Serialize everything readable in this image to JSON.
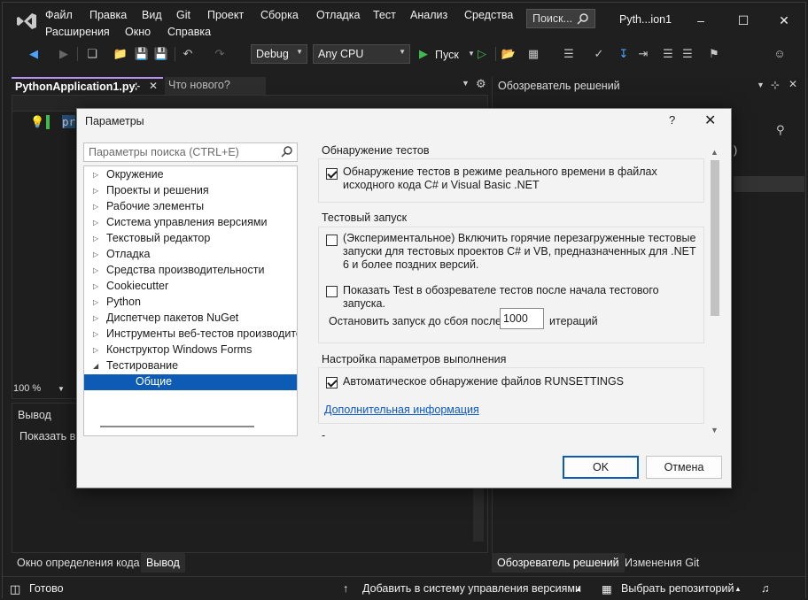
{
  "window": {
    "menu": [
      "Файл",
      "Правка",
      "Вид",
      "Git",
      "Проект",
      "Сборка",
      "Отладка",
      "Тест",
      "Анализ",
      "Средства",
      "Расширения",
      "Окно",
      "Справка"
    ],
    "search_label": "Поиск...",
    "title": "Pyth...ion1"
  },
  "toolbar": {
    "config": "Debug",
    "platform": "Any CPU",
    "run_label": "Пуск"
  },
  "editor": {
    "active_tab": "PythonApplication1.py",
    "inactive_tab": "Что нового?",
    "code_snippet": "pr",
    "zoom": "100 %"
  },
  "output": {
    "title": "Вывод",
    "show_label": "Показать вы"
  },
  "bottom_tabs_left": [
    "Окно определения кода",
    "Вывод"
  ],
  "solution": {
    "title": "Обозреватель решений",
    "fragment": ")"
  },
  "bottom_tabs_right": [
    "Обозреватель решений",
    "Изменения Git"
  ],
  "status": {
    "ready": "Готово",
    "add_vcs": "Добавить в систему управления версиями",
    "select_repo": "Выбрать репозиторий"
  },
  "dialog": {
    "title": "Параметры",
    "help": "?",
    "search_placeholder": "Параметры поиска (CTRL+E)",
    "tree": [
      {
        "label": "Окружение",
        "expanded": false
      },
      {
        "label": "Проекты и решения",
        "expanded": false
      },
      {
        "label": "Рабочие элементы",
        "expanded": false
      },
      {
        "label": "Система управления версиями",
        "expanded": false
      },
      {
        "label": "Текстовый редактор",
        "expanded": false
      },
      {
        "label": "Отладка",
        "expanded": false
      },
      {
        "label": "Средства производительности",
        "expanded": false
      },
      {
        "label": "Cookiecutter",
        "expanded": false
      },
      {
        "label": "Python",
        "expanded": false
      },
      {
        "label": "Диспетчер пакетов NuGet",
        "expanded": false
      },
      {
        "label": "Инструменты веб-тестов производител",
        "expanded": false
      },
      {
        "label": "Конструктор Windows Forms",
        "expanded": false
      },
      {
        "label": "Тестирование",
        "expanded": true
      }
    ],
    "tree_selected": "Общие",
    "sections": {
      "discovery": {
        "title": "Обнаружение тестов",
        "realtime_label": "Обнаружение тестов в режиме реального времени в файлах исходного кода C# и Visual Basic .NET",
        "realtime_checked": true
      },
      "run": {
        "title": "Тестовый запуск",
        "hot_reload_label": "(Экспериментальное) Включить горячие перезагруженные тестовые запуски для тестовых проектов C# и VB, предназначенных для .NET 6 и более поздних версий.",
        "hot_reload_checked": false,
        "show_test_label": "Показать Test в обозревателе тестов после начала тестового запуска.",
        "show_test_checked": false,
        "stop_after_label": "Остановить запуск до сбоя после",
        "stop_after_value": "1000",
        "stop_after_unit": "итераций"
      },
      "runsettings": {
        "title": "Настройка параметров выполнения",
        "auto_label": "Автоматическое обнаружение файлов RUNSETTINGS",
        "auto_checked": true,
        "more_info": "Дополнительная информация"
      }
    },
    "bottom_dash": "-",
    "ok": "OK",
    "cancel": "Отмена"
  }
}
